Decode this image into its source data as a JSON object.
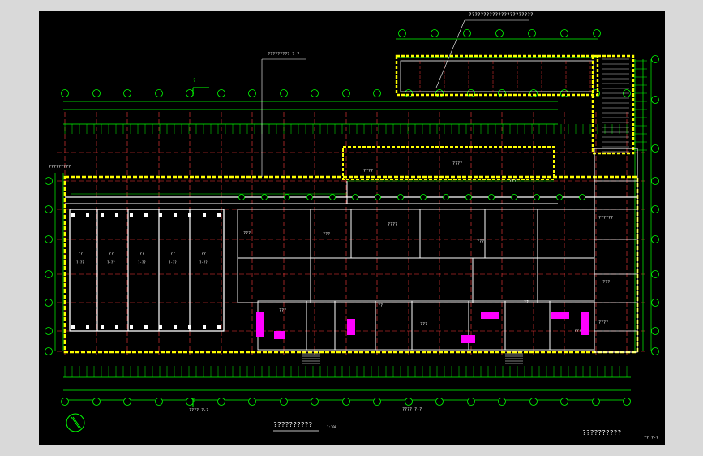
{
  "drawing": {
    "annotation_top": "??????????????????????",
    "annotation_left": "?????????  ?-?",
    "section_marker_top": "?",
    "section_marker_bottom": "?",
    "section_label_bottom": "???? ?-?",
    "section_label_bottom2": "???? ?-?",
    "note_left": "?????????",
    "room_labels": [
      "????",
      "????",
      "???",
      "???",
      "????",
      "???",
      "??????",
      "???",
      "????",
      "???",
      "??",
      "???",
      "??",
      "???",
      "???"
    ],
    "bay_labels": [
      "??",
      "??",
      "??",
      "??",
      "??"
    ],
    "bay_sublabels": [
      "?-??",
      "?-??",
      "?-??",
      "?-??",
      "?-??"
    ],
    "title_center": "??????????",
    "scale_center": "1:100",
    "title_right": "??????????",
    "sheet_number": "?? ?-?"
  },
  "colors": {
    "background": "#000000",
    "frame": "#d9d9d9",
    "wall": "#ffffff",
    "axis": "#ff3b3b",
    "dimension": "#00ff00",
    "highlight": "#ffff00",
    "stair": "#ff00ff",
    "text": "#ffffff"
  },
  "icons": {
    "north_arrow": "north-arrow-icon",
    "axis_bubble": "axis-bubble-icon"
  }
}
